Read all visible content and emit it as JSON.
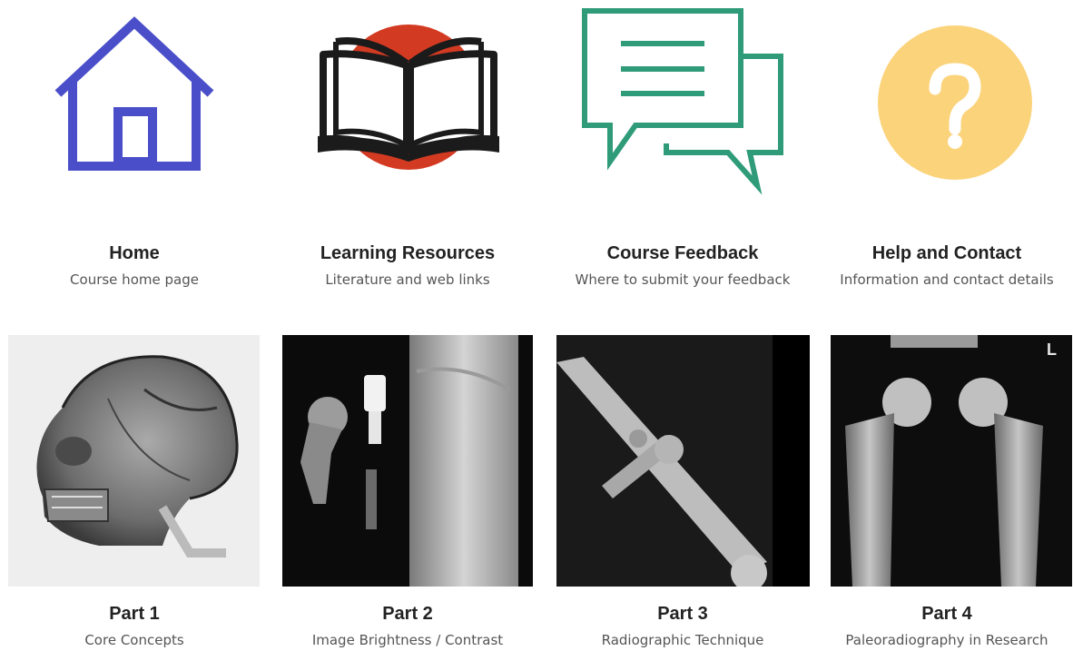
{
  "top_tiles": [
    {
      "title": "Home",
      "subtitle": "Course home page",
      "icon": "house-icon",
      "color": "#4a4fc9"
    },
    {
      "title": "Learning Resources",
      "subtitle": "Literature and web links",
      "icon": "open-book-icon",
      "color": "#d33a22"
    },
    {
      "title": "Course Feedback",
      "subtitle": "Where to submit your feedback",
      "icon": "speech-bubbles-icon",
      "color": "#2f9b78"
    },
    {
      "title": "Help and Contact",
      "subtitle": "Information and contact details",
      "icon": "question-mark-icon",
      "color": "#fbd37a"
    }
  ],
  "bottom_tiles": [
    {
      "title": "Part 1",
      "subtitle": "Core Concepts",
      "image": "skull-xray-image"
    },
    {
      "title": "Part 2",
      "subtitle": "Image Brightness / Contrast",
      "image": "femur-implant-xray-image"
    },
    {
      "title": "Part 3",
      "subtitle": "Radiographic Technique",
      "image": "crossed-femur-xray-image"
    },
    {
      "title": "Part 4",
      "subtitle": "Paleoradiography in Research",
      "image": "paired-femurs-xray-image"
    }
  ],
  "marker_text": "L"
}
